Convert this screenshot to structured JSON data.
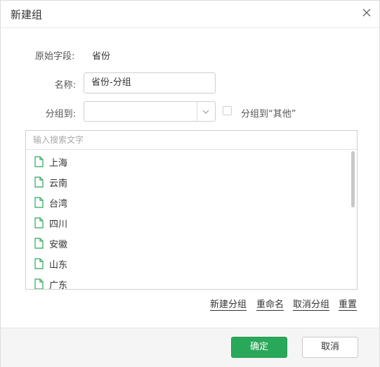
{
  "dialog": {
    "title": "新建组"
  },
  "form": {
    "source_label": "原始字段:",
    "source_value": "省份",
    "name_label": "名称:",
    "name_value": "省份-分组",
    "group_to_label": "分组到:",
    "group_to_value": "",
    "other_checkbox_label": "分组到“其他”",
    "other_checked": false
  },
  "list": {
    "search_placeholder": "输入搜索文字",
    "items": [
      "上海",
      "云南",
      "台湾",
      "四川",
      "安徽",
      "山东",
      "广东"
    ]
  },
  "actions": {
    "new_group": "新建分组",
    "rename": "重命名",
    "ungroup": "取消分组",
    "reset": "重置"
  },
  "footer": {
    "ok": "确定",
    "cancel": "取消"
  },
  "colors": {
    "primary": "#2aa85a",
    "file_icon": "#2aa85a"
  }
}
